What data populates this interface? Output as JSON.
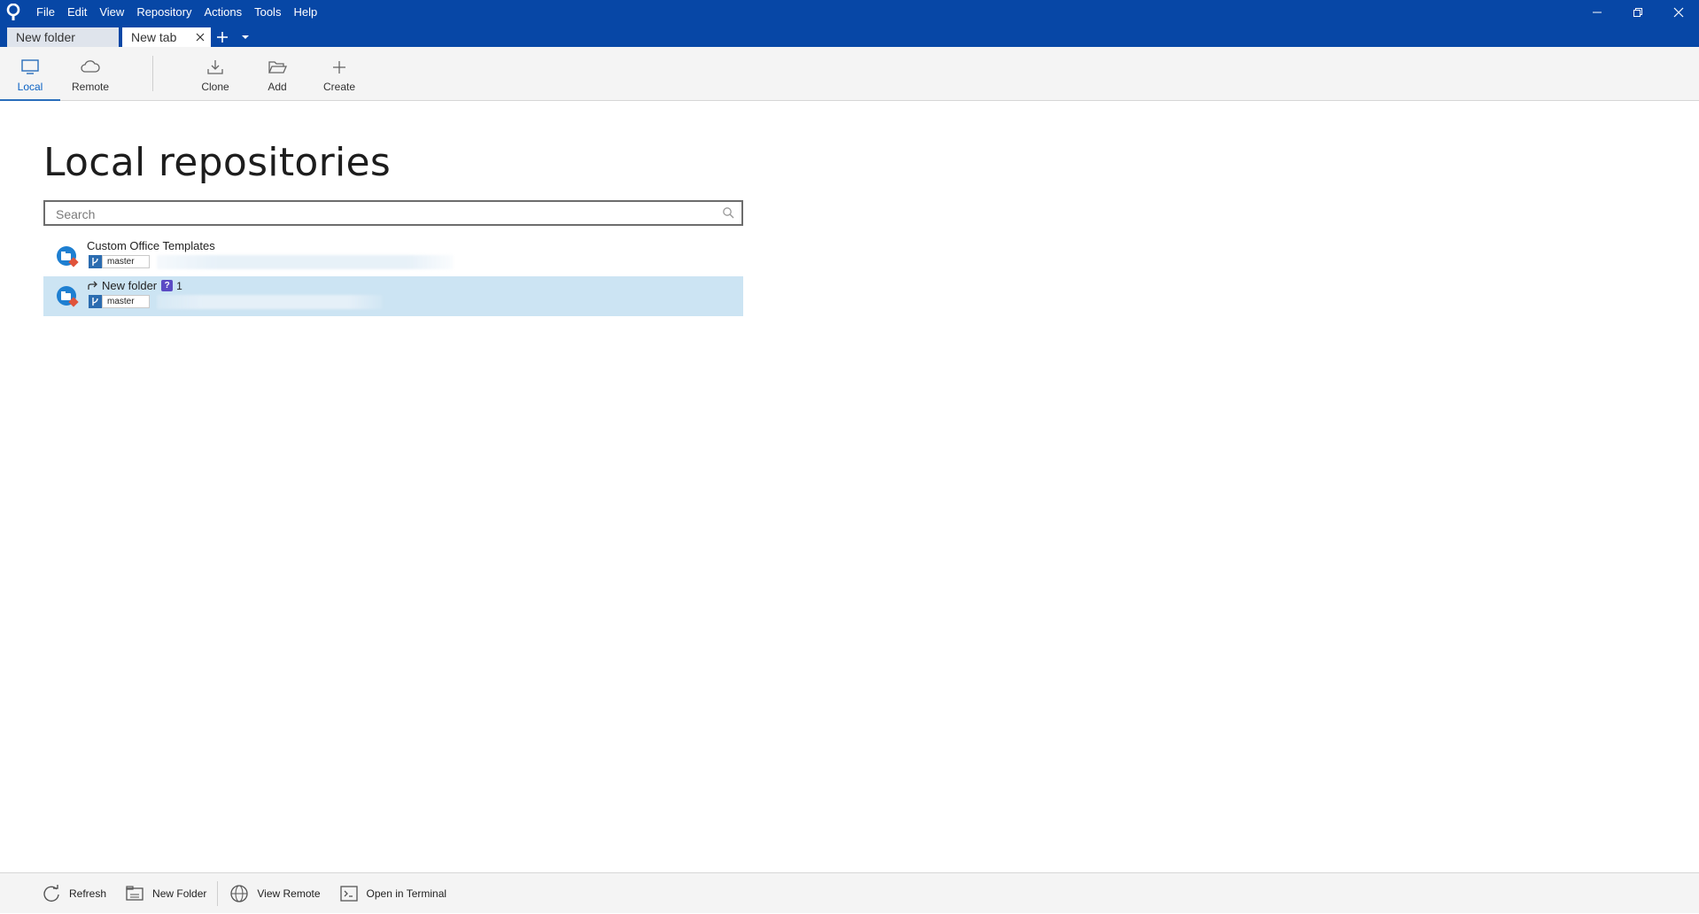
{
  "menu": {
    "items": [
      "File",
      "Edit",
      "View",
      "Repository",
      "Actions",
      "Tools",
      "Help"
    ]
  },
  "tabs": [
    {
      "label": "New folder",
      "active": false
    },
    {
      "label": "New tab",
      "active": true
    }
  ],
  "toolbar": {
    "local": "Local",
    "remote": "Remote",
    "clone": "Clone",
    "add": "Add",
    "create": "Create"
  },
  "main": {
    "title": "Local repositories",
    "search_placeholder": "Search"
  },
  "repos": [
    {
      "name": "Custom Office Templates",
      "branch": "master",
      "selected": false
    },
    {
      "name": "New folder",
      "branch": "master",
      "badge": "?",
      "count": "1",
      "selected": true
    }
  ],
  "bottombar": {
    "refresh": "Refresh",
    "new_folder": "New Folder",
    "view_remote": "View Remote",
    "open_terminal": "Open in Terminal"
  },
  "colors": {
    "titlebar": "#0747a6",
    "selected_row": "#cce4f3",
    "accent": "#2a6ebb"
  }
}
